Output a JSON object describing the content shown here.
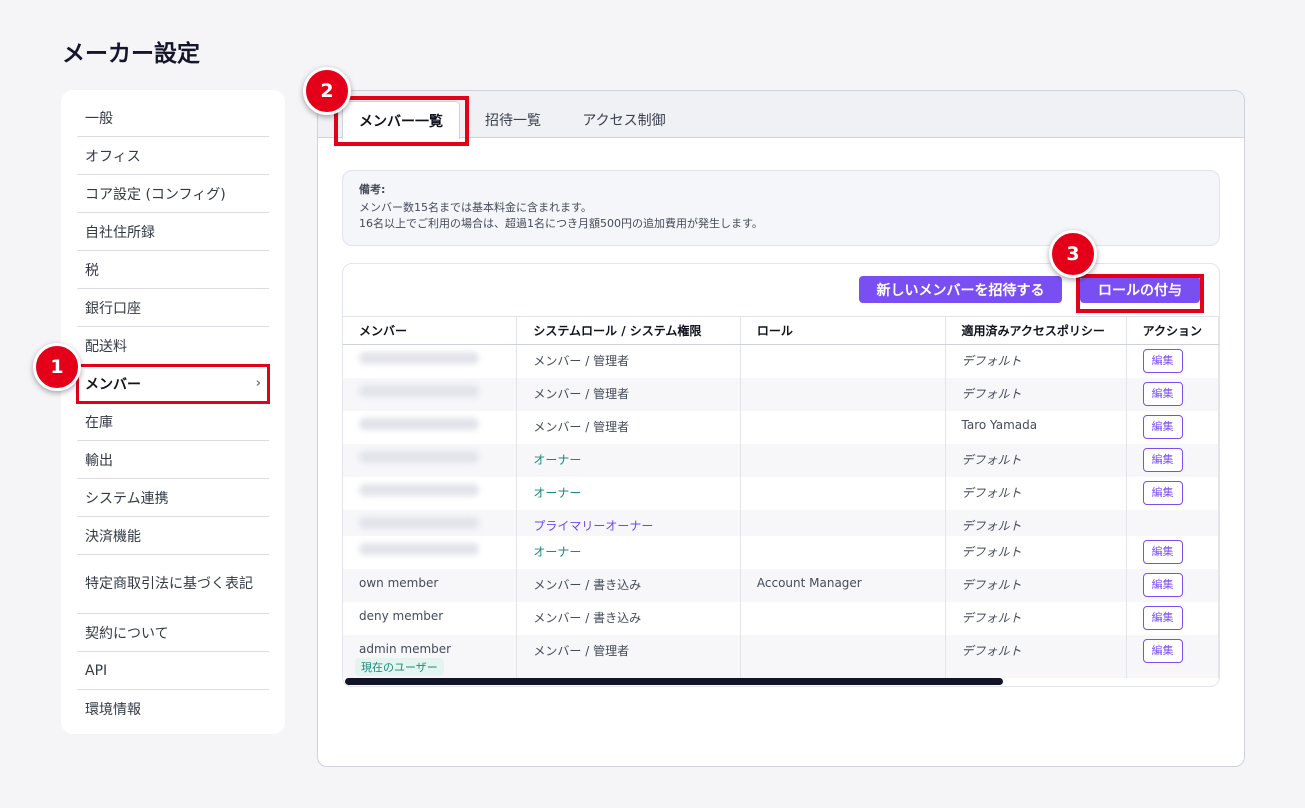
{
  "page": {
    "title": "メーカー設定"
  },
  "sidebar": {
    "items": [
      {
        "label": "一般"
      },
      {
        "label": "オフィス"
      },
      {
        "label": "コア設定 (コンフィグ)"
      },
      {
        "label": "自社住所録"
      },
      {
        "label": "税"
      },
      {
        "label": "銀行口座"
      },
      {
        "label": "配送料"
      },
      {
        "label": "メンバー",
        "chevron": "›"
      },
      {
        "label": "在庫"
      },
      {
        "label": "輸出"
      },
      {
        "label": "システム連携"
      },
      {
        "label": "決済機能"
      },
      {
        "label": "特定商取引法に基づく表記"
      },
      {
        "label": "契約について"
      },
      {
        "label": "API"
      },
      {
        "label": "環境情報"
      }
    ]
  },
  "badges": [
    "1",
    "2",
    "3"
  ],
  "tabs": [
    {
      "label": "メンバー一覧"
    },
    {
      "label": "招待一覧"
    },
    {
      "label": "アクセス制御"
    }
  ],
  "note": {
    "title": "備考:",
    "line1": "メンバー数15名までは基本料金に含まれます。",
    "line2": "16名以上でご利用の場合は、超過1名につき月額500円の追加費用が発生します。"
  },
  "actions": {
    "invite_label": "新しいメンバーを招待する",
    "assign_role_label": "ロールの付与"
  },
  "table": {
    "headers": [
      "メンバー",
      "システムロール / システム権限",
      "ロール",
      "適用済みアクセスポリシー",
      "アクション"
    ],
    "edit_label": "編集",
    "current_user_label": "現在のユーザー",
    "rows": [
      {
        "member": "",
        "system_role": "メンバー / 管理者",
        "role": "",
        "policy": "デフォルト"
      },
      {
        "member": "",
        "system_role": "メンバー / 管理者",
        "role": "",
        "policy": "デフォルト"
      },
      {
        "member": "",
        "system_role": "メンバー / 管理者",
        "role": "",
        "policy": "Taro Yamada"
      },
      {
        "member": "",
        "system_role": "オーナー",
        "role": "",
        "policy": "デフォルト"
      },
      {
        "member": "",
        "system_role": "オーナー",
        "role": "",
        "policy": "デフォルト"
      },
      {
        "member": "",
        "system_role": "プライマリーオーナー",
        "role": "",
        "policy": "デフォルト"
      },
      {
        "member": "",
        "system_role": "オーナー",
        "role": "",
        "policy": "デフォルト"
      },
      {
        "member": "own member",
        "system_role": "メンバー / 書き込み",
        "role": "Account Manager",
        "policy": "デフォルト"
      },
      {
        "member": "deny member",
        "system_role": "メンバー / 書き込み",
        "role": "",
        "policy": "デフォルト"
      },
      {
        "member": "admin member",
        "system_role": "メンバー / 管理者",
        "role": "",
        "policy": "デフォルト"
      }
    ]
  },
  "colors": {
    "accent": "#7a4ff2",
    "highlight": "#e5001a",
    "owner": "#1b8a78",
    "primary_owner": "#6d49e6"
  }
}
